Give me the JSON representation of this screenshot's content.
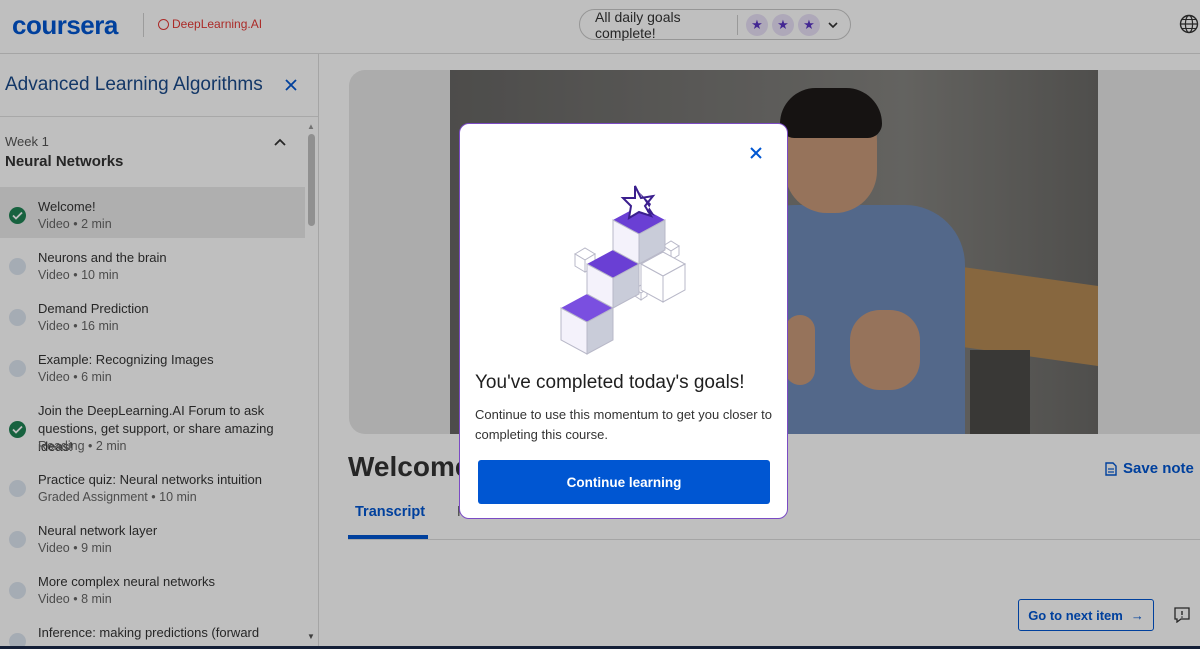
{
  "header": {
    "logo": "coursera",
    "partner": "DeepLearning.AI",
    "goals_text": "All daily goals complete!",
    "stars": [
      "★",
      "★",
      "★"
    ],
    "colors": {
      "brand": "#0056d2",
      "partner": "#e53935",
      "star": "#5a35c5"
    }
  },
  "sidebar": {
    "course_title": "Advanced Learning Algorithms",
    "week_label": "Week 1",
    "week_name": "Neural Networks",
    "items": [
      {
        "title": "Welcome!",
        "type": "Video",
        "duration": "2 min",
        "done": true,
        "active": true
      },
      {
        "title": "Neurons and the brain",
        "type": "Video",
        "duration": "10 min",
        "done": false
      },
      {
        "title": "Demand Prediction",
        "type": "Video",
        "duration": "16 min",
        "done": false
      },
      {
        "title": "Example: Recognizing Images",
        "type": "Video",
        "duration": "6 min",
        "done": false
      },
      {
        "title": "Join the DeepLearning.AI Forum to ask questions, get support, or share amazing ideas!",
        "type": "Reading",
        "duration": "2 min",
        "done": true
      },
      {
        "title": "Practice quiz: Neural networks intuition",
        "type": "Graded Assignment",
        "duration": "10 min",
        "done": false
      },
      {
        "title": "Neural network layer",
        "type": "Video",
        "duration": "9 min",
        "done": false
      },
      {
        "title": "More complex neural networks",
        "type": "Video",
        "duration": "8 min",
        "done": false
      },
      {
        "title": "Inference: making predictions (forward",
        "type": "",
        "duration": "",
        "done": false
      }
    ]
  },
  "main": {
    "lesson_title": "Welcome!",
    "save_note": "Save note",
    "tabs": [
      {
        "label": "Transcript",
        "active": true
      },
      {
        "label": "N",
        "active": false
      }
    ],
    "next_button": "Go to next item",
    "next_arrow": "→"
  },
  "modal": {
    "title": "You've completed today's goals!",
    "body": "Continue to use this momentum to get you closer to completing this course.",
    "button": "Continue learning",
    "colors": {
      "accent": "#7b4bc4",
      "button": "#0056d2"
    }
  }
}
